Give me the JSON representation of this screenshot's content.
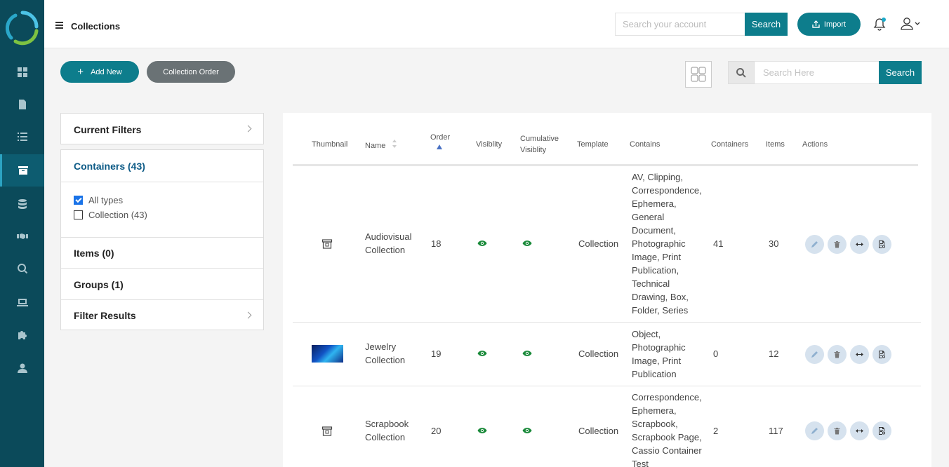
{
  "header": {
    "title": "Collections",
    "search_placeholder": "Search your account",
    "search_button": "Search",
    "import_button": "Import"
  },
  "toolbar": {
    "add_new": "Add New",
    "collection_order": "Collection Order",
    "search_placeholder": "Search Here",
    "search_button": "Search"
  },
  "filters": {
    "current_filters": "Current Filters",
    "containers": "Containers (43)",
    "options": [
      {
        "label": "All types",
        "checked": true
      },
      {
        "label": "Collection (43)",
        "checked": false
      }
    ],
    "items": "Items (0)",
    "groups": "Groups (1)",
    "filter_results": "Filter Results"
  },
  "table": {
    "headers": {
      "thumbnail": "Thumbnail",
      "name": "Name",
      "order": "Order",
      "visibility": "Visiblity",
      "cumulative_1": "Cumulative",
      "cumulative_2": "Visiblity",
      "template": "Template",
      "contains": "Contains",
      "containers": "Containers",
      "items": "Items",
      "actions": "Actions"
    },
    "rows": [
      {
        "name_1": "Audiovisual",
        "name_2": "Collection",
        "order": "18",
        "template": "Collection",
        "contains": [
          "AV, Clipping,",
          "Correspondence,",
          "Ephemera,",
          "General",
          "Document,",
          "Photographic",
          "Image, Print",
          "Publication,",
          "Technical",
          "Drawing, Box,",
          "Folder, Series"
        ],
        "containers": "41",
        "items": "30"
      },
      {
        "name_1": "Jewelry",
        "name_2": "Collection",
        "order": "19",
        "template": "Collection",
        "contains": [
          "Object,",
          "Photographic",
          "Image, Print",
          "Publication"
        ],
        "containers": "0",
        "items": "12"
      },
      {
        "name_1": "Scrapbook",
        "name_2": "Collection",
        "order": "20",
        "template": "Collection",
        "contains": [
          "Correspondence,",
          "Ephemera,",
          "Scrapbook,",
          "Scrapbook Page,",
          "Cassio Container",
          "Test"
        ],
        "containers": "2",
        "items": "117"
      }
    ]
  },
  "colors": {
    "sidebar": "#0b4a5a",
    "accent": "#0d7d8c",
    "visibility": "#1a8a3a"
  }
}
